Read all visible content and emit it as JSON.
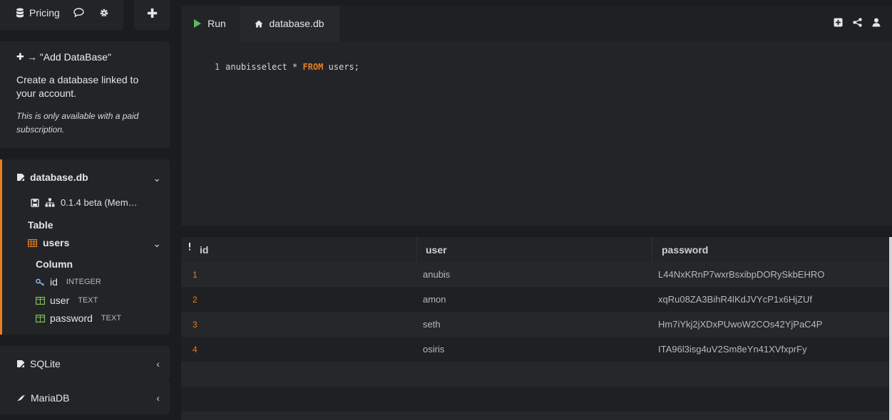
{
  "topbar": {
    "pricing_label": "Pricing"
  },
  "add_database": {
    "title": "→ \"Add DataBase\"",
    "description": "Create a database linked to your account.",
    "note": "This is only available with a paid subscription."
  },
  "database": {
    "name": "database.db",
    "version": "0.1.4 beta (Mem…",
    "table_heading": "Table",
    "table_name": "users",
    "column_heading": "Column",
    "columns": [
      {
        "name": "id",
        "type": "INTEGER",
        "icon": "key-icon"
      },
      {
        "name": "user",
        "type": "TEXT",
        "icon": "column-icon"
      },
      {
        "name": "password",
        "type": "TEXT",
        "icon": "column-icon"
      }
    ]
  },
  "engines": [
    {
      "label": "SQLite"
    },
    {
      "label": "MariaDB"
    }
  ],
  "editor": {
    "run_label": "Run",
    "tab_label": "database.db",
    "line_number": "1",
    "code_before": "anubisselect * ",
    "code_keyword": "FROM",
    "code_after": " users;"
  },
  "results": {
    "headers": [
      "id",
      "user",
      "password"
    ],
    "rows": [
      [
        "1",
        "anubis",
        "L44NxKRnP7wxrBsxibpDORySkbEHRO"
      ],
      [
        "2",
        "amon",
        "xqRu08ZA3BihR4lKdJVYcP1x6HjZUf"
      ],
      [
        "3",
        "seth",
        "Hm7iYkj2jXDxPUwoW2COs42YjPaC4P"
      ],
      [
        "4",
        "osiris",
        "ITA96l3isg4uV2Sm8eYn41XVfxprFy"
      ]
    ]
  },
  "colors": {
    "accent": "#e67e22",
    "run_green": "#5cb85c",
    "panel": "#232427",
    "background": "#1b1c1f"
  }
}
